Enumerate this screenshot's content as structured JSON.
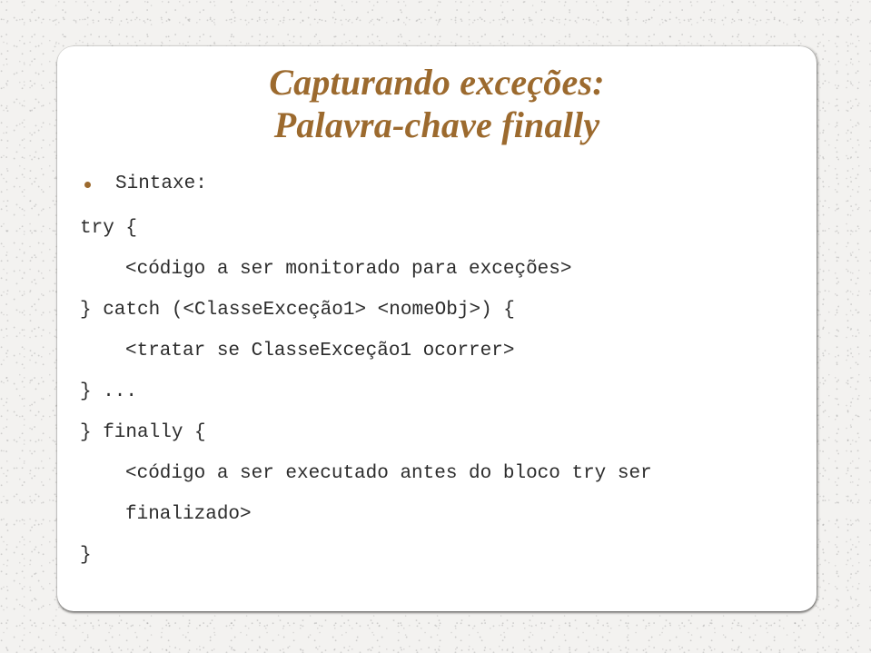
{
  "slide": {
    "title": {
      "line1": "Capturando exceções:",
      "line2": "Palavra-chave finally",
      "color": "#9c6a2e"
    },
    "bullet": {
      "marker": "bullet-dot",
      "label": "Sintaxe:"
    },
    "code": {
      "text_color": "#2c2c2c",
      "lines": [
        {
          "text": "try {",
          "indent": false
        },
        {
          "text": "<código a ser monitorado para exceções>",
          "indent": true
        },
        {
          "text": "} catch (<ClasseExceção1> <nomeObj>) {",
          "indent": false
        },
        {
          "text": "<tratar se ClasseExceção1 ocorrer>",
          "indent": true
        },
        {
          "text": "} ...",
          "indent": false
        },
        {
          "text": "} finally {",
          "indent": false
        },
        {
          "text": "<código a ser executado antes do bloco try ser",
          "indent": true
        },
        {
          "text": "finalizado>",
          "indent": true
        },
        {
          "text": "}",
          "indent": false
        }
      ]
    },
    "card": {
      "background": "#ffffff"
    },
    "page": {
      "background": "#f3f2f0"
    }
  }
}
